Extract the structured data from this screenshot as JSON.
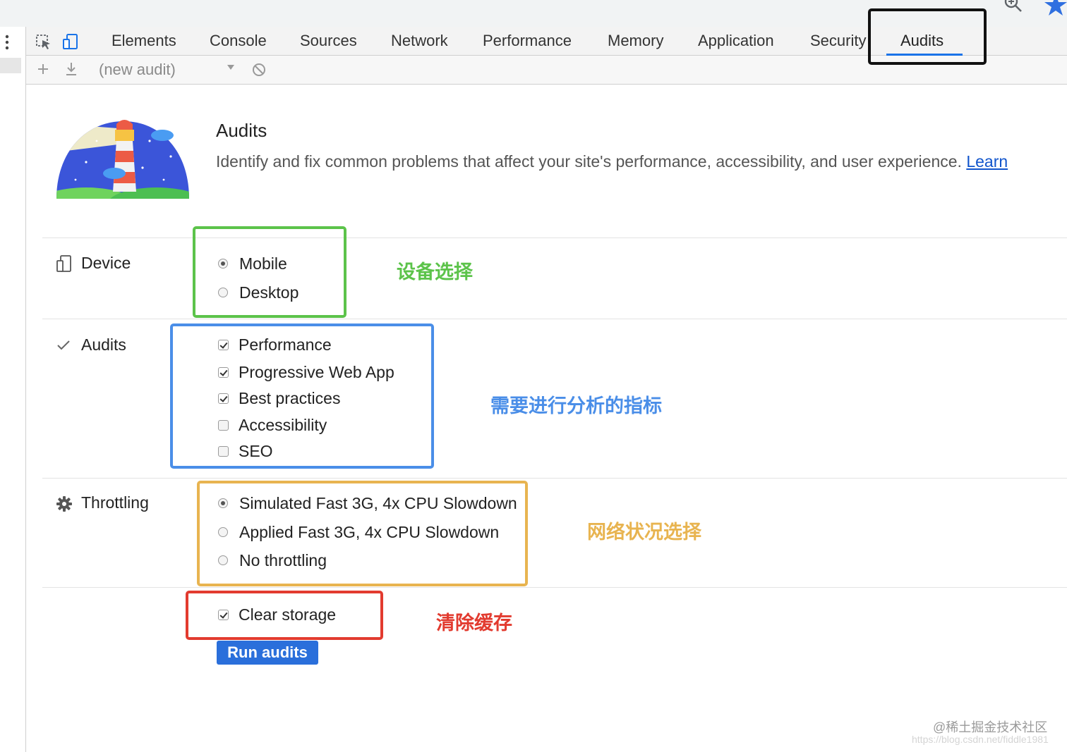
{
  "devtools": {
    "tabs": [
      "Elements",
      "Console",
      "Sources",
      "Network",
      "Performance",
      "Memory",
      "Application",
      "Security",
      "Audits"
    ],
    "active_tab": "Audits"
  },
  "toolbar": {
    "audit_select_value": "(new audit)"
  },
  "header": {
    "title": "Audits",
    "description": "Identify and fix common problems that affect your site's performance, accessibility, and user experience.",
    "learn_link": "Learn"
  },
  "sections": {
    "device": {
      "label": "Device",
      "options": [
        {
          "label": "Mobile",
          "selected": true
        },
        {
          "label": "Desktop",
          "selected": false
        }
      ]
    },
    "audits": {
      "label": "Audits",
      "options": [
        {
          "label": "Performance",
          "checked": true
        },
        {
          "label": "Progressive Web App",
          "checked": true
        },
        {
          "label": "Best practices",
          "checked": true
        },
        {
          "label": "Accessibility",
          "checked": false
        },
        {
          "label": "SEO",
          "checked": false
        }
      ]
    },
    "throttling": {
      "label": "Throttling",
      "options": [
        {
          "label": "Simulated Fast 3G, 4x CPU Slowdown",
          "selected": true
        },
        {
          "label": "Applied Fast 3G, 4x CPU Slowdown",
          "selected": false
        },
        {
          "label": "No throttling",
          "selected": false
        }
      ]
    },
    "storage": {
      "label": "Clear storage",
      "checked": true
    }
  },
  "run_button": "Run audits",
  "annotations": {
    "device": "设备选择",
    "categories": "需要进行分析的指标",
    "throttling": "网络状况选择",
    "storage": "清除缓存"
  },
  "annotation_colors": {
    "audits_tab": "#111111",
    "device": "#5cc34a",
    "categories": "#4a8ee8",
    "throttling": "#e8b450",
    "storage": "#e23b2f"
  },
  "watermark": {
    "line1": "@稀土掘金技术社区",
    "line2": "https://blog.csdn.net/fiddle1981"
  },
  "icons": [
    "zoom-icon",
    "star-icon",
    "kebab-icon",
    "inspect-icon",
    "device-toggle-icon",
    "plus-icon",
    "download-icon",
    "clear-icon",
    "lighthouse-logo",
    "device-icon",
    "checkmark-icon",
    "gear-icon"
  ]
}
